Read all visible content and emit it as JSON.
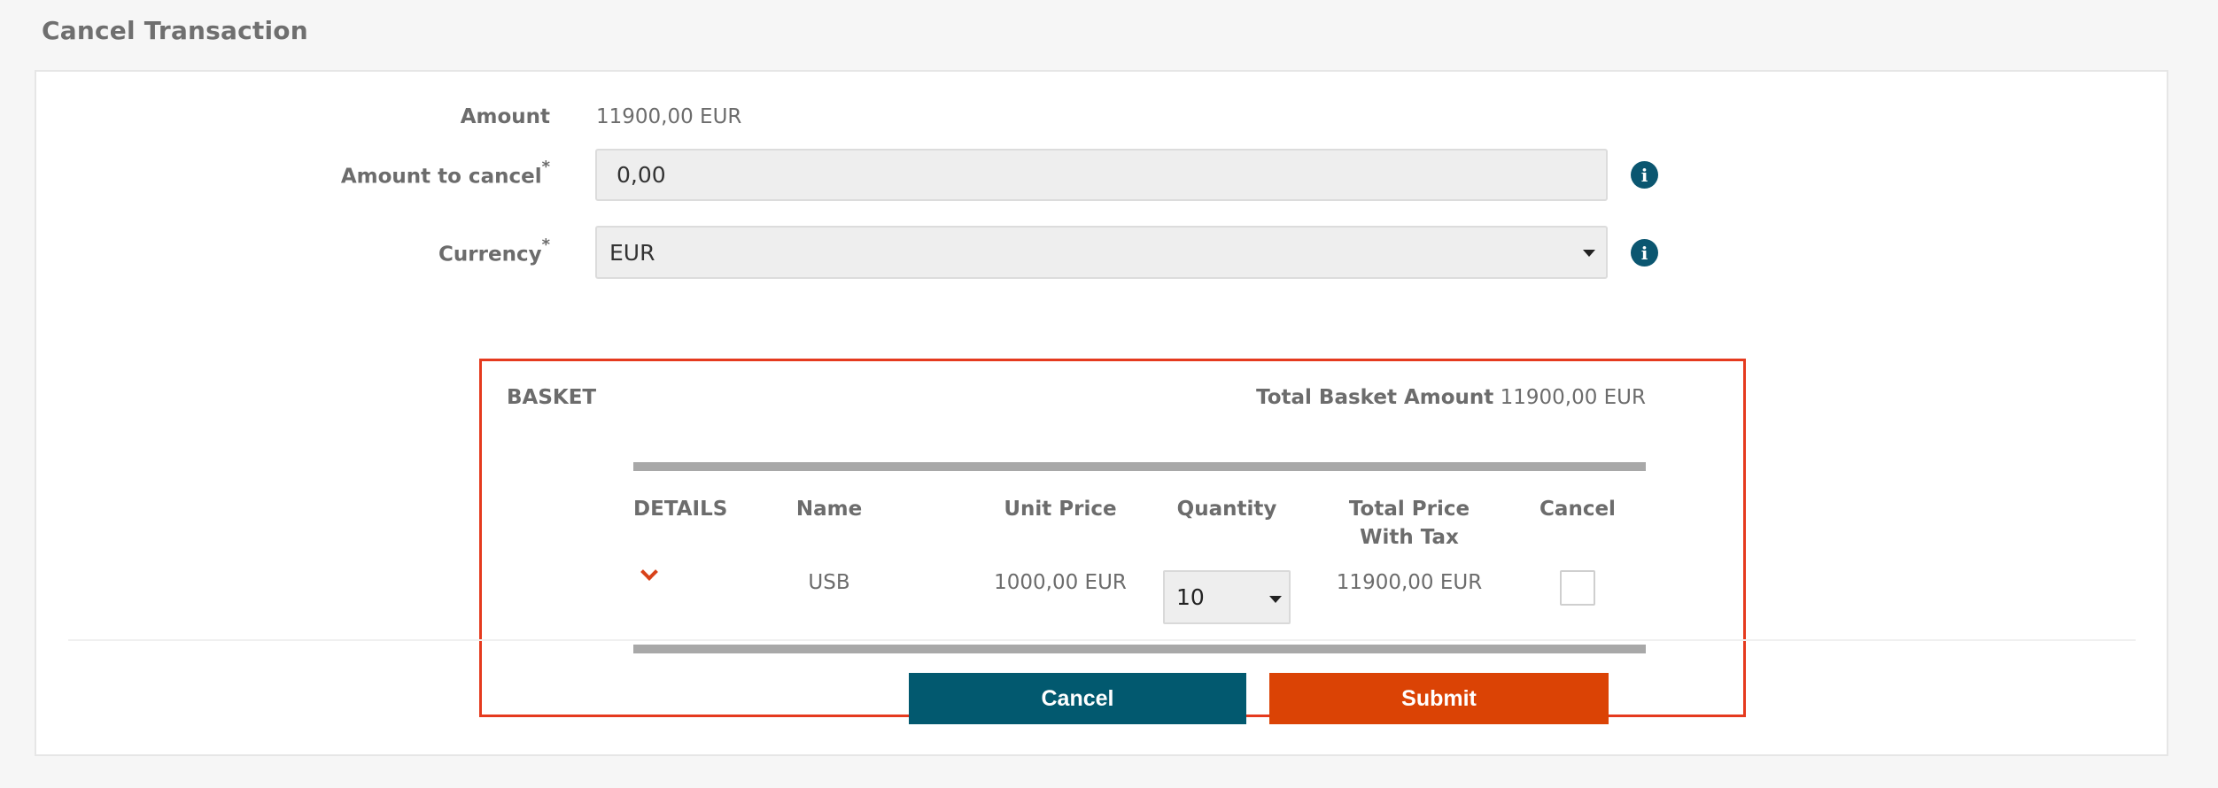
{
  "page": {
    "title": "Cancel Transaction"
  },
  "form": {
    "amount_label": "Amount",
    "amount_value": "11900,00 EUR",
    "amount_to_cancel_label": "Amount to cancel",
    "amount_to_cancel_value": "0,00",
    "currency_label": "Currency",
    "currency_value": "EUR",
    "required_marker": "*"
  },
  "basket": {
    "label": "BASKET",
    "total_label": "Total Basket Amount",
    "total_value": "11900,00 EUR",
    "columns": {
      "details": "DETAILS",
      "name": "Name",
      "unit_price": "Unit Price",
      "quantity": "Quantity",
      "total_price_line1": "Total Price",
      "total_price_line2": "With Tax",
      "cancel": "Cancel"
    },
    "rows": [
      {
        "name": "USB",
        "unit_price": "1000,00 EUR",
        "quantity": "10",
        "total_price": "11900,00 EUR",
        "cancel_checked": false
      }
    ]
  },
  "actions": {
    "cancel_label": "Cancel",
    "submit_label": "Submit"
  },
  "colors": {
    "accent_border": "#e53a1e",
    "primary": "#02596f",
    "submit": "#db4305"
  }
}
